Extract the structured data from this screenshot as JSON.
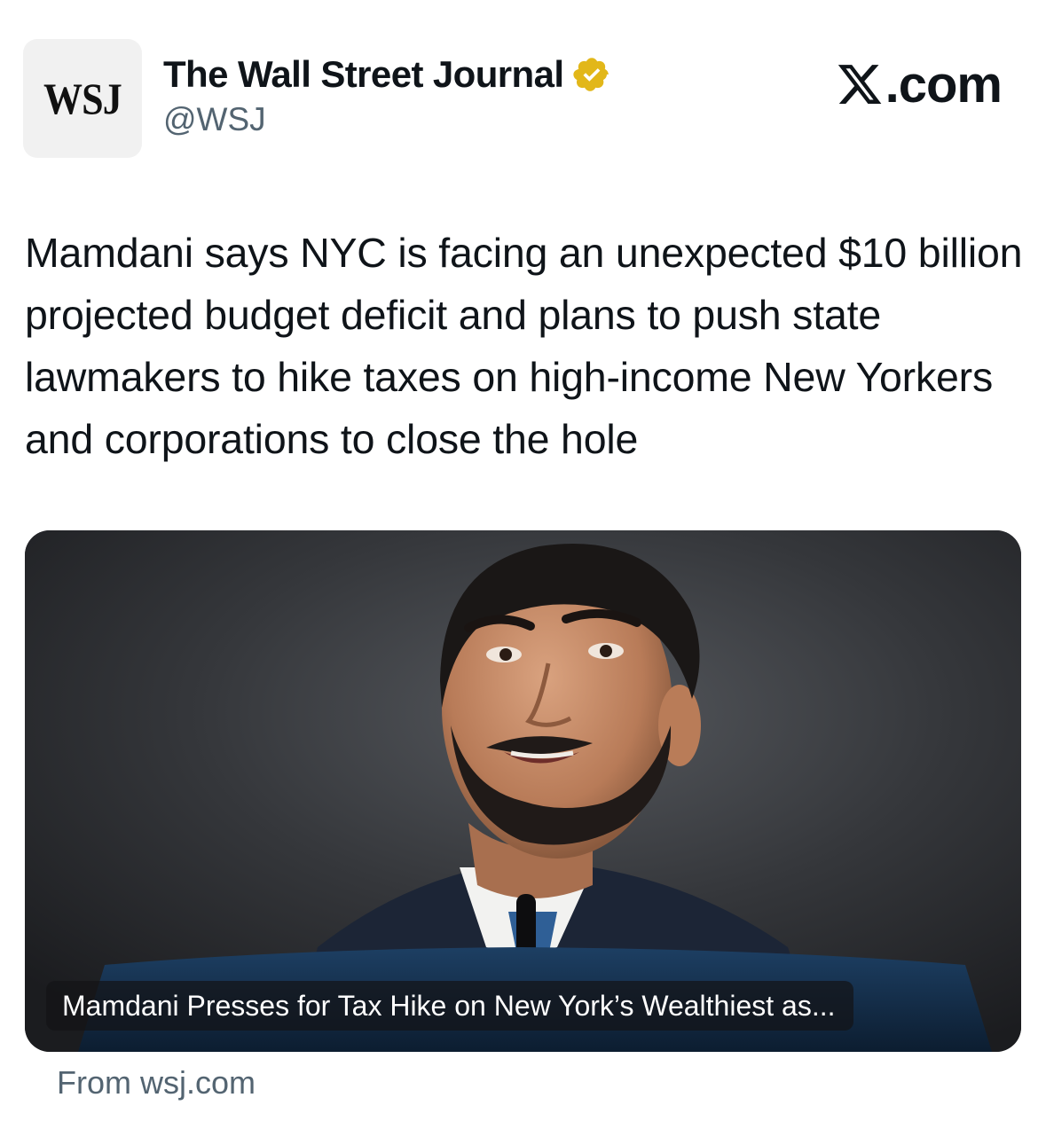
{
  "account": {
    "avatar_text": "WSJ",
    "name": "The Wall Street Journal",
    "handle": "@WSJ",
    "verified": true,
    "verified_icon": "gold-verified-badge",
    "verified_color": "#e2b719"
  },
  "platform": {
    "logo_icon": "x-logo",
    "label": ".com"
  },
  "tweet": {
    "text": "Mamdani says NYC is facing an unexpected $10 billion projected budget deficit and plans to push state lawmakers to hike taxes on high-income New Yorkers and corporations to close the hole"
  },
  "link_card": {
    "headline": "Mamdani Presses for Tax Hike on New York’s Wealthiest as...",
    "source": "From wsj.com"
  }
}
